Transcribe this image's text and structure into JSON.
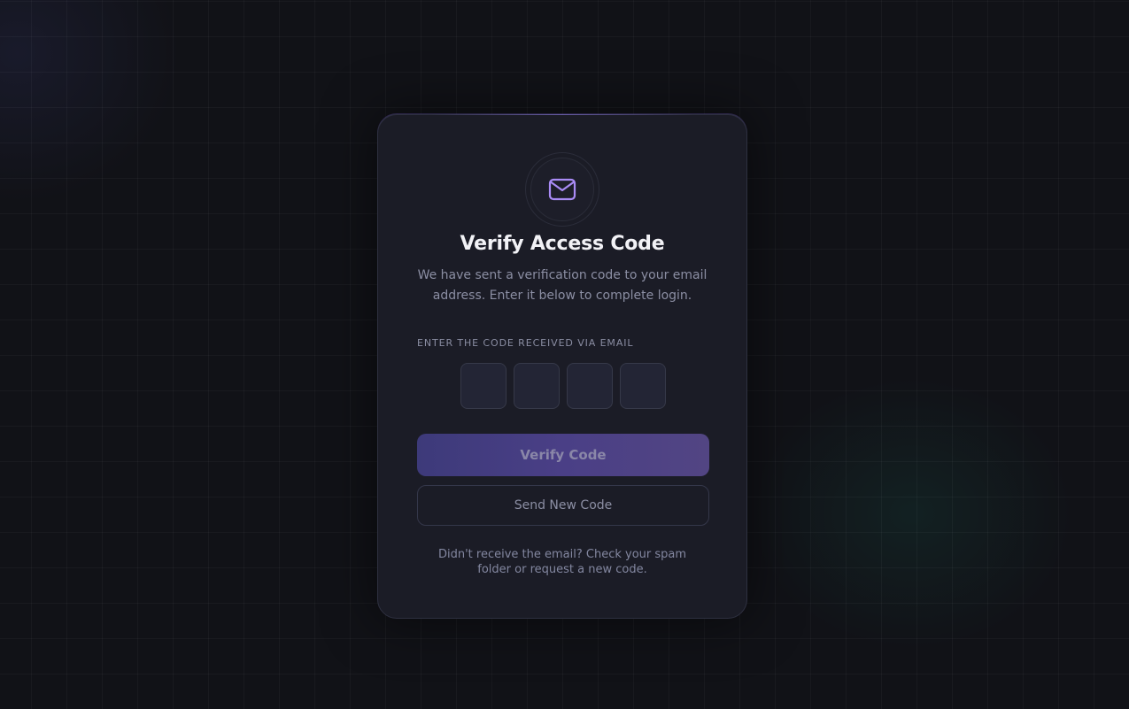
{
  "card": {
    "icon": "mail-icon",
    "title": "Verify Access Code",
    "subtitle": "We have sent a verification code to your email address. Enter it below to complete login.",
    "code_label": "ENTER THE CODE RECEIVED VIA EMAIL",
    "code_digits": [
      "",
      "",
      "",
      ""
    ],
    "verify_label": "Verify Code",
    "resend_label": "Send New Code",
    "help_text": "Didn't receive the email? Check your spam folder or request a new code."
  },
  "colors": {
    "background": "#111217",
    "card": "#1b1c26",
    "accent": "#a98bf5",
    "verify_button_start": "#3d3a7a",
    "verify_button_end": "#524583"
  }
}
